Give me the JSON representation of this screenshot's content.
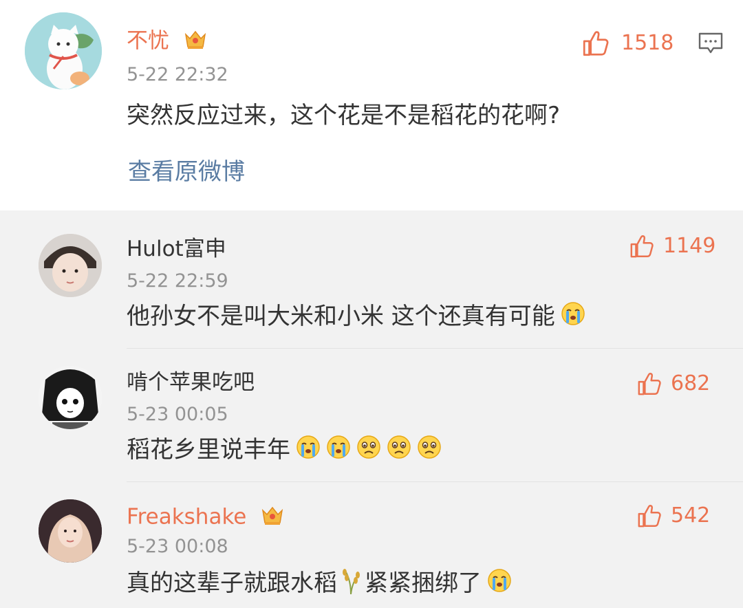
{
  "main_comment": {
    "author": "不忧",
    "time": "5-22 22:32",
    "likes": "1518",
    "text": "突然反应过来，这个花是不是稻花的花啊?",
    "view_original": "查看原微博",
    "colors": {
      "name": "#eb7350",
      "link": "#5a7ca3"
    }
  },
  "replies": [
    {
      "author": "Hulot富申",
      "time": "5-22 22:59",
      "likes": "1149",
      "text": "他孙女不是叫大米和小米 这个还真有可能",
      "emojis": [
        "crying-emoji"
      ]
    },
    {
      "author": "啃个苹果吃吧",
      "time": "5-23 00:05",
      "likes": "682",
      "text": "稻花乡里说丰年",
      "emojis": [
        "crying-emoji",
        "crying-emoji",
        "sad-emoji",
        "sad-emoji",
        "sad-emoji"
      ]
    },
    {
      "author": "Freakshake",
      "time": "5-23 00:08",
      "likes": "542",
      "text_before": "真的这辈子就跟水稻",
      "text_after": "紧紧捆绑了",
      "emojis": [
        "rice-emoji",
        "crying-emoji"
      ]
    }
  ]
}
